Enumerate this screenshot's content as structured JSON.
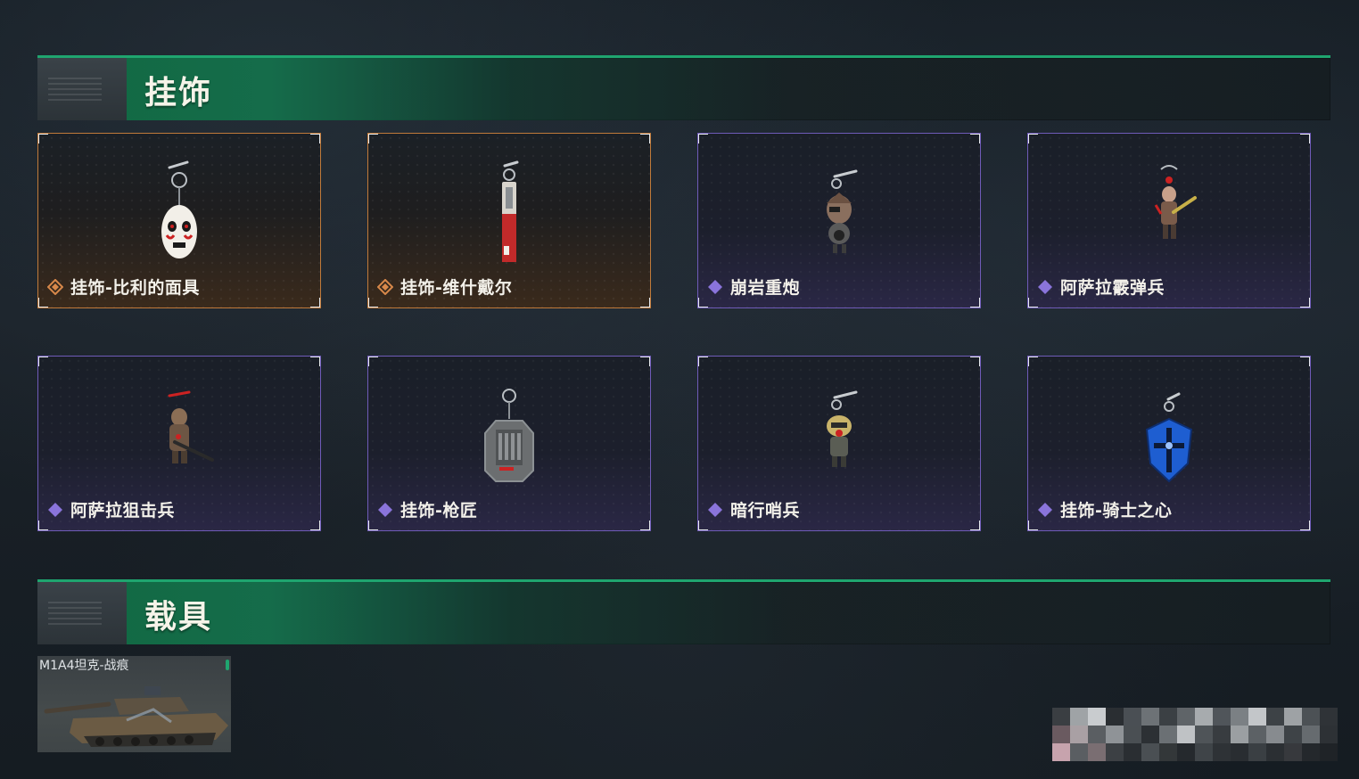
{
  "sections": [
    {
      "title": "挂饰"
    },
    {
      "title": "载具"
    }
  ],
  "charms": [
    {
      "name": "挂饰-比利的面具",
      "rarity": "orange",
      "icon": "jigsaw-mask-charm-icon"
    },
    {
      "name": "挂饰-维什戴尔",
      "rarity": "orange",
      "icon": "red-blade-charm-icon"
    },
    {
      "name": "崩岩重炮",
      "rarity": "purple",
      "icon": "heavy-gunner-figure-charm-icon"
    },
    {
      "name": "阿萨拉霰弹兵",
      "rarity": "purple",
      "icon": "shotgunner-figure-charm-icon"
    },
    {
      "name": "阿萨拉狙击兵",
      "rarity": "purple",
      "icon": "sniper-figure-charm-icon"
    },
    {
      "name": "挂饰-枪匠",
      "rarity": "purple",
      "icon": "gun-case-charm-icon"
    },
    {
      "name": "暗行哨兵",
      "rarity": "purple",
      "icon": "sentry-figure-charm-icon"
    },
    {
      "name": "挂饰-骑士之心",
      "rarity": "purple",
      "icon": "knight-heart-shield-charm-icon"
    }
  ],
  "vehicle": {
    "name": "M1A4坦克-战痕",
    "icon": "tank-icon"
  },
  "colors": {
    "accent_green": "#1fa56f",
    "rarity_orange": "#d7884a",
    "rarity_purple": "#8a74db"
  }
}
